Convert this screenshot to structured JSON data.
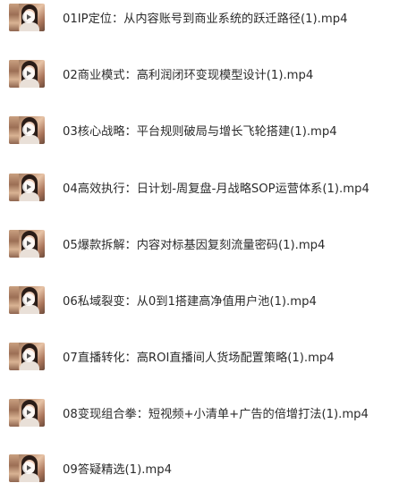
{
  "files": [
    {
      "name": "01IP定位：从内容账号到商业系统的跃迁路径(1).mp4",
      "thumbnail_icon": "video-thumbnail-icon"
    },
    {
      "name": "02商业模式：高利润闭环变现模型设计(1).mp4",
      "thumbnail_icon": "video-thumbnail-icon"
    },
    {
      "name": "03核心战略：平台规则破局与增长飞轮搭建(1).mp4",
      "thumbnail_icon": "video-thumbnail-icon"
    },
    {
      "name": "04高效执行：日计划-周复盘-月战略SOP运营体系(1).mp4",
      "thumbnail_icon": "video-thumbnail-icon"
    },
    {
      "name": "05爆款拆解：内容对标基因复刻流量密码(1).mp4",
      "thumbnail_icon": "video-thumbnail-icon"
    },
    {
      "name": "06私域裂变：从0到1搭建高净值用户池(1).mp4",
      "thumbnail_icon": "video-thumbnail-icon"
    },
    {
      "name": "07直播转化：高ROI直播间人货场配置策略(1).mp4",
      "thumbnail_icon": "video-thumbnail-icon"
    },
    {
      "name": "08变现组合拳：短视频+小清单+广告的倍增打法(1).mp4",
      "thumbnail_icon": "video-thumbnail-icon"
    },
    {
      "name": "09答疑精选(1).mp4",
      "thumbnail_icon": "video-thumbnail-icon"
    }
  ]
}
